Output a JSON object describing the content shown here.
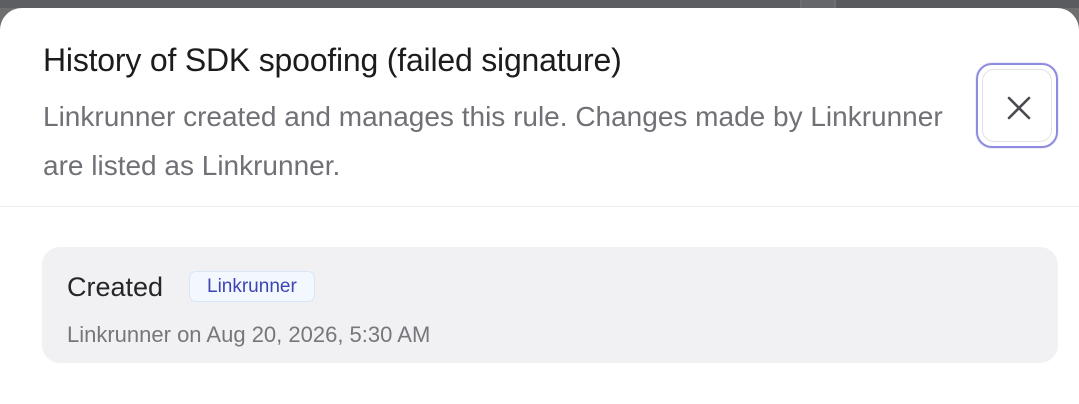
{
  "dialog": {
    "title": "History of SDK spoofing (failed signature)",
    "subtitle": "Linkrunner created and manages this rule. Changes made by Linkrunner are listed as Linkrunner.",
    "close_icon": "close-icon"
  },
  "history": [
    {
      "event": "Created",
      "badge": "Linkrunner",
      "meta": "Linkrunner on Aug 20, 2026, 5:30 AM"
    }
  ],
  "colors": {
    "accent_focus_ring": "#8f8ce0",
    "badge_text": "#3d44b3",
    "card_background": "#f1f1f3"
  }
}
